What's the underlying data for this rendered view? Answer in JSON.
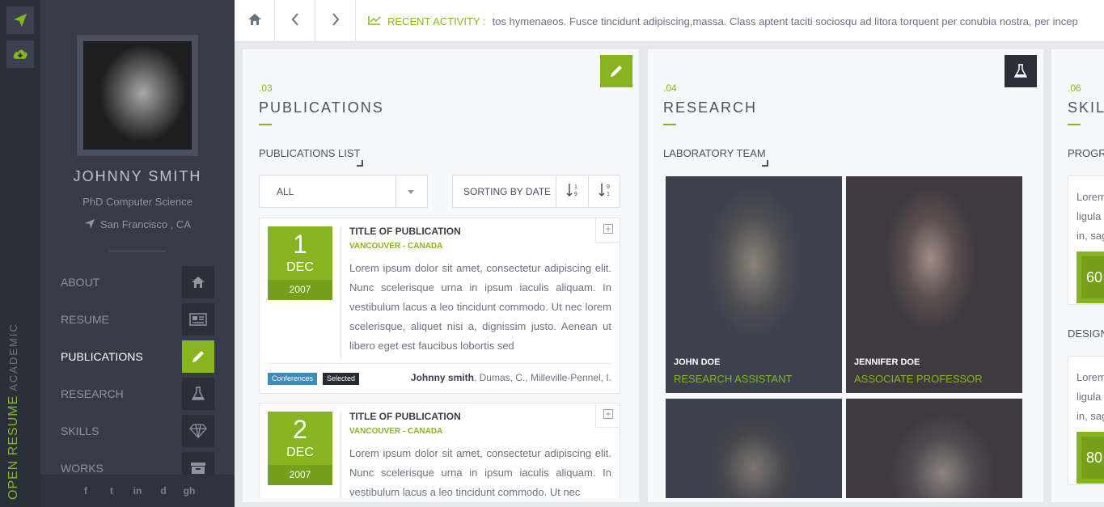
{
  "app": {
    "rail_title_main": "OPEN RESUME",
    "rail_title_sub": "ACADEMIC"
  },
  "profile": {
    "name": "JOHNNY SMITH",
    "title": "PhD Computer Science",
    "location": "San Francisco , CA"
  },
  "nav": [
    {
      "label": "ABOUT",
      "icon": "home-icon"
    },
    {
      "label": "RESUME",
      "icon": "newspaper-icon"
    },
    {
      "label": "PUBLICATIONS",
      "icon": "pencil-icon",
      "active": true
    },
    {
      "label": "RESEARCH",
      "icon": "flask-icon"
    },
    {
      "label": "SKILLS",
      "icon": "diamond-icon"
    },
    {
      "label": "WORKS",
      "icon": "archive-icon"
    }
  ],
  "social": [
    "f",
    "t",
    "in",
    "d",
    "gh"
  ],
  "topbar": {
    "activity_label": "RECENT ACTIVITY :",
    "activity_text": "tos hymenaeos. Fusce tincidunt adipiscing,massa. Class aptent taciti sociosqu ad litora torquent per conubia nostra, per incep"
  },
  "publications": {
    "number": ".03",
    "heading": "PUBLICATIONS",
    "subheading": "PUBLICATIONS LIST",
    "filter_value": "ALL",
    "sort_label": "SORTING BY DATE",
    "items": [
      {
        "day": "1",
        "month": "DEC",
        "year": "2007",
        "title": "TITLE OF PUBLICATION",
        "location": "VANCOUVER - CANADA",
        "body": "Lorem ipsum dolor sit amet, consectetur adipiscing elit. Nunc scelerisque urna in ipsum iaculis aliquam. In vestibulum lacus a leo tincidunt commodo. Ut nec lorem scelerisque, aliquet nisi a, dignissim justo. Aenean ut libero eget est faucibus lobortis sed",
        "tag1": "Conferences",
        "tag2": "Selected",
        "author_bold": "Johnny smith",
        "authors_rest": ", Dumas, C., Milleville-Pennel, I."
      },
      {
        "day": "2",
        "month": "DEC",
        "year": "2007",
        "title": "TITLE OF PUBLICATION",
        "location": "VANCOUVER - CANADA",
        "body": "Lorem ipsum dolor sit amet, consectetur adipiscing elit. Nunc scelerisque urna in ipsum iaculis aliquam. In vestibulum lacus a leo tincidunt commodo. Ut nec"
      }
    ]
  },
  "research": {
    "number": ".04",
    "heading": "RESEARCH",
    "subheading": "LABORATORY TEAM",
    "team": [
      {
        "name": "JOHN DOE",
        "role": "RESEARCH ASSISTANT"
      },
      {
        "name": "JENNIFER DOE",
        "role": "ASSOCIATE PROFESSOR"
      },
      {
        "name": "",
        "role": ""
      },
      {
        "name": "",
        "role": ""
      }
    ]
  },
  "skills": {
    "number": ".06",
    "heading": "SKIL",
    "group1": "PROGR",
    "group2": "DESIGN",
    "box1_lines": [
      "Lorem",
      "ligula",
      "in, sag"
    ],
    "box1_value": "60",
    "box2_lines": [
      "Lorem",
      "ligula",
      "in, sag"
    ],
    "box2_value": "80"
  },
  "colors": {
    "accent": "#86b520",
    "sidebar": "#363b48",
    "rail": "#2b2f38"
  }
}
